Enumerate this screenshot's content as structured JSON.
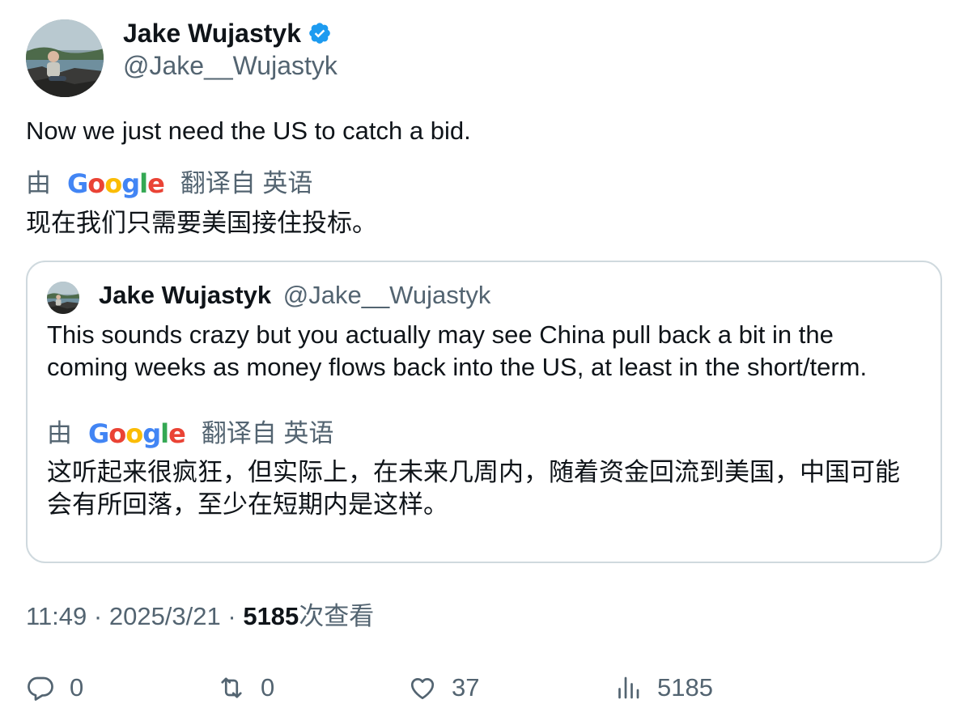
{
  "author": {
    "name": "Jake Wujastyk",
    "handle": "@Jake__Wujastyk",
    "verified": true
  },
  "tweet": {
    "text": "Now we just need the US to catch a bid.",
    "translation": {
      "by_label": "由",
      "provider": "Google",
      "from_label": "翻译自 英语",
      "text": "现在我们只需要美国接住投标。"
    }
  },
  "quoted_tweet": {
    "name": "Jake Wujastyk",
    "handle": "@Jake__Wujastyk",
    "text": "This sounds crazy but you actually may see China pull back a bit in the coming weeks as money flows back into the US, at least in the short/term.",
    "translation": {
      "by_label": "由",
      "provider": "Google",
      "from_label": "翻译自 英语",
      "text": "这听起来很疯狂，但实际上，在未来几周内，随着资金回流到美国，中国可能会有所回落，至少在短期内是这样。"
    }
  },
  "meta": {
    "time": "11:49",
    "separator": " · ",
    "date": "2025/3/21",
    "views_count": "5185",
    "views_label": "次查看"
  },
  "actions": {
    "reply_count": "0",
    "retweet_count": "0",
    "like_count": "37",
    "views_count": "5185"
  },
  "colors": {
    "text_primary": "#0f1419",
    "text_secondary": "#536471",
    "verified_blue": "#1d9bf0",
    "border": "#cfd9de"
  },
  "icons": [
    "verified-badge-icon",
    "reply-icon",
    "retweet-icon",
    "like-icon",
    "views-icon"
  ]
}
